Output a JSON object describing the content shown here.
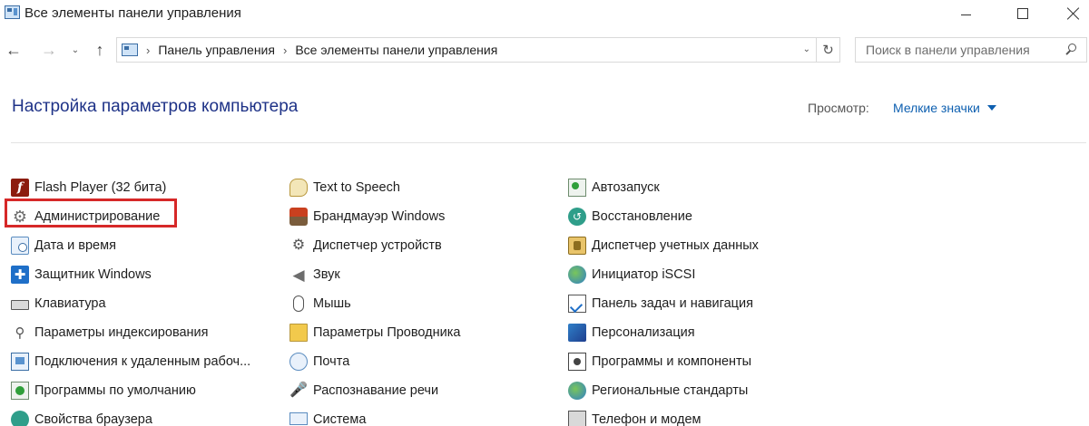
{
  "window": {
    "title": "Все элементы панели управления",
    "minimize": "Свернуть",
    "maximize": "Развернуть",
    "close": "Закрыть"
  },
  "nav": {
    "back_icon": "arrow-left",
    "forward_icon": "arrow-right",
    "recent_icon": "chevron-down",
    "up_icon": "arrow-up",
    "back_glyph": "←",
    "forward_glyph": "→",
    "recent_glyph": "⌄",
    "up_glyph": "↑",
    "breadcrumb_sep": "›",
    "breadcrumbs": [
      "Панель управления",
      "Все элементы панели управления"
    ],
    "dropdown_glyph": "⌄",
    "refresh_glyph": "↻",
    "search_placeholder": "Поиск в панели управления"
  },
  "header": {
    "title": "Настройка параметров компьютера",
    "view_label": "Просмотр:",
    "view_value": "Мелкие значки"
  },
  "colors": {
    "title": "#1e3287",
    "link": "#0d5fb0",
    "highlight": "#d62828"
  },
  "columns": [
    {
      "items": [
        {
          "label": "Flash Player (32 бита)",
          "icon": "flash-player-icon",
          "glyph": "f"
        },
        {
          "label": "Администрирование",
          "icon": "administration-icon",
          "glyph": "⚙"
        },
        {
          "label": "Дата и время",
          "icon": "date-time-icon",
          "glyph": ""
        },
        {
          "label": "Защитник Windows",
          "icon": "windows-defender-icon",
          "glyph": "✚"
        },
        {
          "label": "Клавиатура",
          "icon": "keyboard-icon",
          "glyph": ""
        },
        {
          "label": "Параметры индексирования",
          "icon": "indexing-options-icon",
          "glyph": "⚲"
        },
        {
          "label": "Подключения к удаленным рабоч...",
          "icon": "remote-connections-icon",
          "glyph": ""
        },
        {
          "label": "Программы по умолчанию",
          "icon": "default-programs-icon",
          "glyph": ""
        },
        {
          "label": "Свойства браузера",
          "icon": "browser-properties-icon",
          "glyph": ""
        }
      ]
    },
    {
      "items": [
        {
          "label": "Text to Speech",
          "icon": "text-to-speech-icon",
          "glyph": ""
        },
        {
          "label": "Брандмауэр Windows",
          "icon": "windows-firewall-icon",
          "glyph": ""
        },
        {
          "label": "Диспетчер устройств",
          "icon": "device-manager-icon",
          "glyph": "⚙"
        },
        {
          "label": "Звук",
          "icon": "sound-icon",
          "glyph": "◀"
        },
        {
          "label": "Мышь",
          "icon": "mouse-icon",
          "glyph": ""
        },
        {
          "label": "Параметры Проводника",
          "icon": "explorer-options-icon",
          "glyph": ""
        },
        {
          "label": "Почта",
          "icon": "mail-icon",
          "glyph": ""
        },
        {
          "label": "Распознавание речи",
          "icon": "speech-recognition-icon",
          "glyph": "🎤"
        },
        {
          "label": "Система",
          "icon": "system-icon",
          "glyph": ""
        }
      ]
    },
    {
      "items": [
        {
          "label": "Автозапуск",
          "icon": "autoplay-icon",
          "glyph": ""
        },
        {
          "label": "Восстановление",
          "icon": "recovery-icon",
          "glyph": "↺"
        },
        {
          "label": "Диспетчер учетных данных",
          "icon": "credential-manager-icon",
          "glyph": ""
        },
        {
          "label": "Инициатор iSCSI",
          "icon": "iscsi-initiator-icon",
          "glyph": ""
        },
        {
          "label": "Панель задач и навигация",
          "icon": "taskbar-navigation-icon",
          "glyph": ""
        },
        {
          "label": "Персонализация",
          "icon": "personalization-icon",
          "glyph": ""
        },
        {
          "label": "Программы и компоненты",
          "icon": "programs-features-icon",
          "glyph": ""
        },
        {
          "label": "Региональные стандарты",
          "icon": "region-icon",
          "glyph": ""
        },
        {
          "label": "Телефон и модем",
          "icon": "phone-modem-icon",
          "glyph": ""
        }
      ]
    }
  ]
}
